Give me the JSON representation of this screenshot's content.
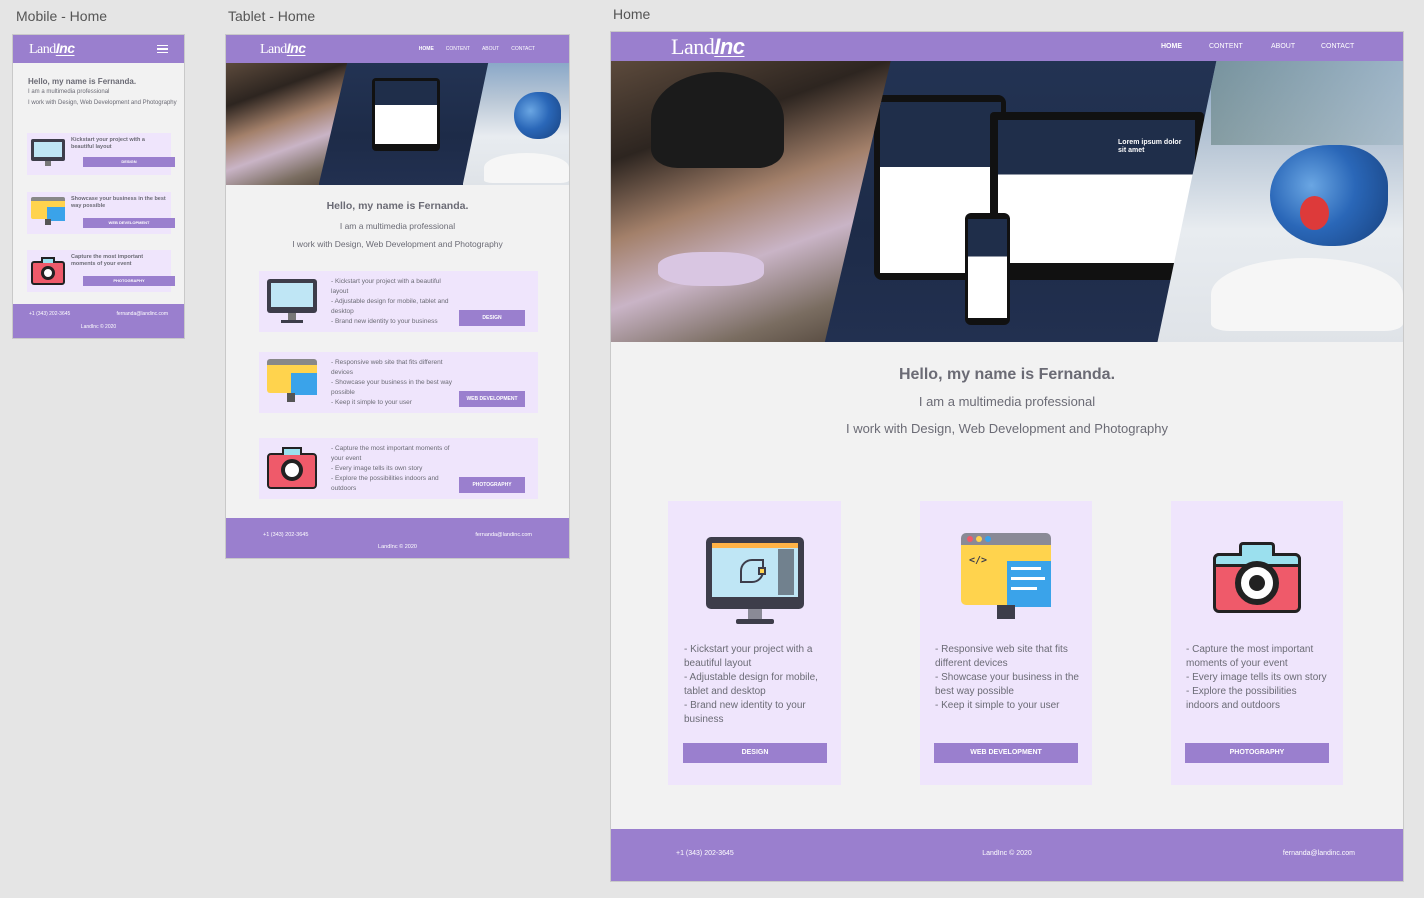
{
  "labels": {
    "mobile": "Mobile - Home",
    "tablet": "Tablet - Home",
    "desktop": "Home"
  },
  "brand": {
    "part1": "Land",
    "part2": "Inc"
  },
  "nav": {
    "home": "HOME",
    "content": "CONTENT",
    "about": "ABOUT",
    "contact": "CONTACT"
  },
  "intro": {
    "hello": "Hello, my name is Fernanda.",
    "role": "I am a multimedia professional",
    "work": "I work with Design, Web Development and Photography"
  },
  "mobile_cards": [
    {
      "text": "Kickstart your project with a beautiful layout",
      "button": "DESIGN"
    },
    {
      "text": "Showcase your business in the best way possible",
      "button": "WEB DEVELOPMENT"
    },
    {
      "text": "Capture the most important moments of your event",
      "button": "PHOTOGRAPHY"
    }
  ],
  "tablet_cards": [
    {
      "lines": [
        "- Kickstart your project with a beautiful layout",
        "- Adjustable design for mobile, tablet and desktop",
        "- Brand new identity to your business"
      ],
      "button": "DESIGN"
    },
    {
      "lines": [
        "- Responsive web site that fits different devices",
        "- Showcase your business in the best way possible",
        "- Keep it simple to your user"
      ],
      "button": "WEB DEVELOPMENT"
    },
    {
      "lines": [
        "- Capture the most important moments of your event",
        "- Every image tells its own story",
        "- Explore the possibilities indoors and outdoors"
      ],
      "button": "PHOTOGRAPHY"
    }
  ],
  "desktop_cards": [
    {
      "lines": [
        "- Kickstart your project with a beautiful layout",
        "- Adjustable design for mobile, tablet and desktop",
        "- Brand new identity to your business"
      ],
      "button": "DESIGN"
    },
    {
      "lines": [
        "- Responsive web site that fits different devices",
        "- Showcase your business in the best way possible",
        "- Keep it simple to your user"
      ],
      "button": "WEB DEVELOPMENT"
    },
    {
      "lines": [
        "- Capture the most important moments of your event",
        "- Every image tells its own story",
        "- Explore the possibilities indoors and outdoors"
      ],
      "button": "PHOTOGRAPHY"
    }
  ],
  "hero_screen": {
    "headline": "Lorem ipsum dolor sit amet"
  },
  "footer": {
    "phone": "+1 (343) 202-3645",
    "email": "fernanda@landinc.com",
    "copyright": "LandInc © 2020"
  },
  "colors": {
    "accent": "#9a7fce",
    "card": "#efe5fc",
    "page": "#f2f2f2"
  },
  "icons": [
    "monitor-design-icon",
    "code-window-icon",
    "camera-icon",
    "hamburger-menu-icon"
  ]
}
